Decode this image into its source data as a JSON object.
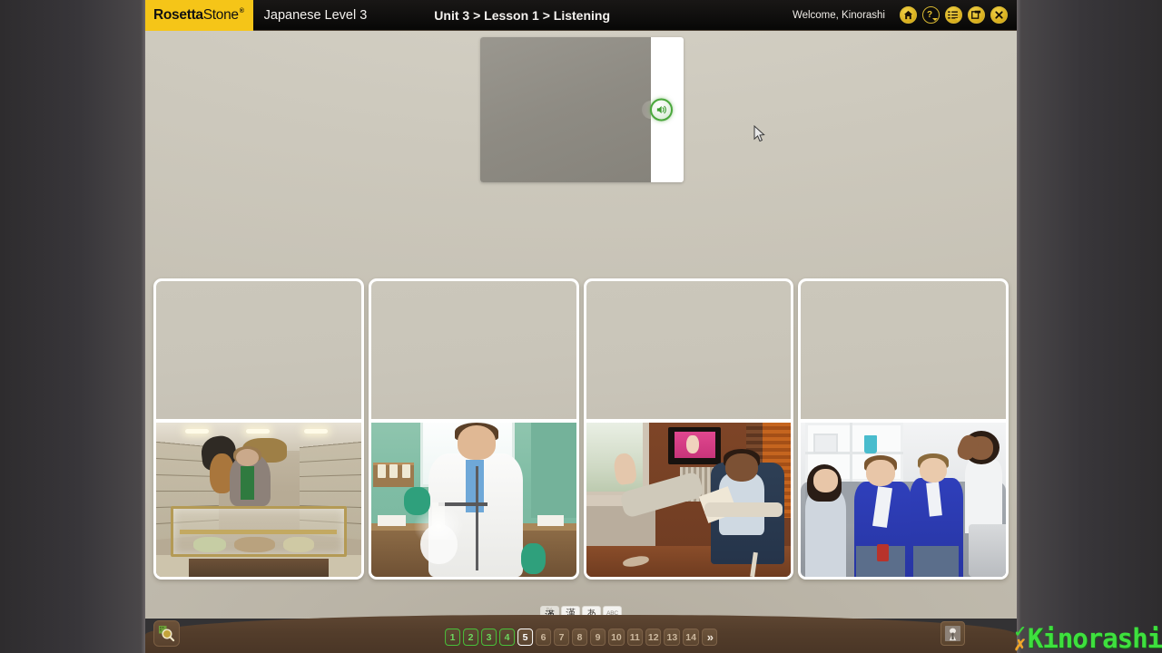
{
  "app": {
    "brand_primary": "Rosetta",
    "brand_secondary": "Stone",
    "brand_tm": "®",
    "course_title": "Japanese Level 3",
    "breadcrumb": "Unit 3 > Lesson 1 > Listening",
    "welcome": "Welcome, Kinorashi",
    "brand_color": "#f5c518",
    "accent_green": "#49c13a",
    "bar_brown": "#533d2b"
  },
  "header_icons": [
    {
      "name": "home-icon",
      "label": "Home",
      "glyph": "⌂",
      "has_caret": false
    },
    {
      "name": "help-icon",
      "label": "Help",
      "glyph": "?",
      "has_caret": true
    },
    {
      "name": "menu-icon",
      "label": "Menu",
      "glyph": "☰",
      "has_caret": true
    },
    {
      "name": "window-icon",
      "label": "Window",
      "glyph": "❐",
      "has_caret": false
    },
    {
      "name": "close-icon",
      "label": "Close",
      "glyph": "×",
      "has_caret": false
    }
  ],
  "prompt": {
    "name": "audio-prompt",
    "play_label": "Play audio",
    "media_state": "blank"
  },
  "cards": [
    {
      "index": 1,
      "text": "",
      "image_alt": "Woman examining specimens in a natural history museum display hall",
      "selected": false
    },
    {
      "index": 2,
      "text": "",
      "image_alt": "Man in white lab coat with green gloves performing a chemistry experiment",
      "selected": false
    },
    {
      "index": 3,
      "text": "",
      "image_alt": "Boy sitting in a chair reading with his feet up on the windowsill, TV on behind him",
      "selected": false
    },
    {
      "index": 4,
      "text": "",
      "image_alt": "Four friends on a sofa, two young men in blue jerseys watching TV excitedly while two women look bored",
      "selected": false
    }
  ],
  "script_toggles": [
    {
      "name": "furigana-toggle",
      "label": "漢",
      "furi": "かん",
      "hint": "Kanji with furigana",
      "active": true
    },
    {
      "name": "kanji-toggle",
      "label": "漢",
      "hint": "Kanji",
      "active": false
    },
    {
      "name": "kana-toggle",
      "label": "あ",
      "hint": "Hiragana",
      "active": false
    },
    {
      "name": "romaji-toggle",
      "label": "ABC",
      "hint": "Romaji",
      "active": false
    }
  ],
  "bottom": {
    "zoom_label": "Zoom",
    "mic_label": "Microphone",
    "next_label": "»"
  },
  "pagination": {
    "current": 5,
    "total": 14,
    "items": [
      {
        "label": "1",
        "state": "done"
      },
      {
        "label": "2",
        "state": "done"
      },
      {
        "label": "3",
        "state": "done"
      },
      {
        "label": "4",
        "state": "done"
      },
      {
        "label": "5",
        "state": "current"
      },
      {
        "label": "6",
        "state": "todo"
      },
      {
        "label": "7",
        "state": "todo"
      },
      {
        "label": "8",
        "state": "todo"
      },
      {
        "label": "9",
        "state": "todo"
      },
      {
        "label": "10",
        "state": "todo"
      },
      {
        "label": "11",
        "state": "todo"
      },
      {
        "label": "12",
        "state": "todo"
      },
      {
        "label": "13",
        "state": "todo"
      },
      {
        "label": "14",
        "state": "todo"
      }
    ]
  },
  "watermark": {
    "name": "Kinorashi",
    "check": "✓",
    "cross": "✗",
    "color": "#3ee03e"
  }
}
